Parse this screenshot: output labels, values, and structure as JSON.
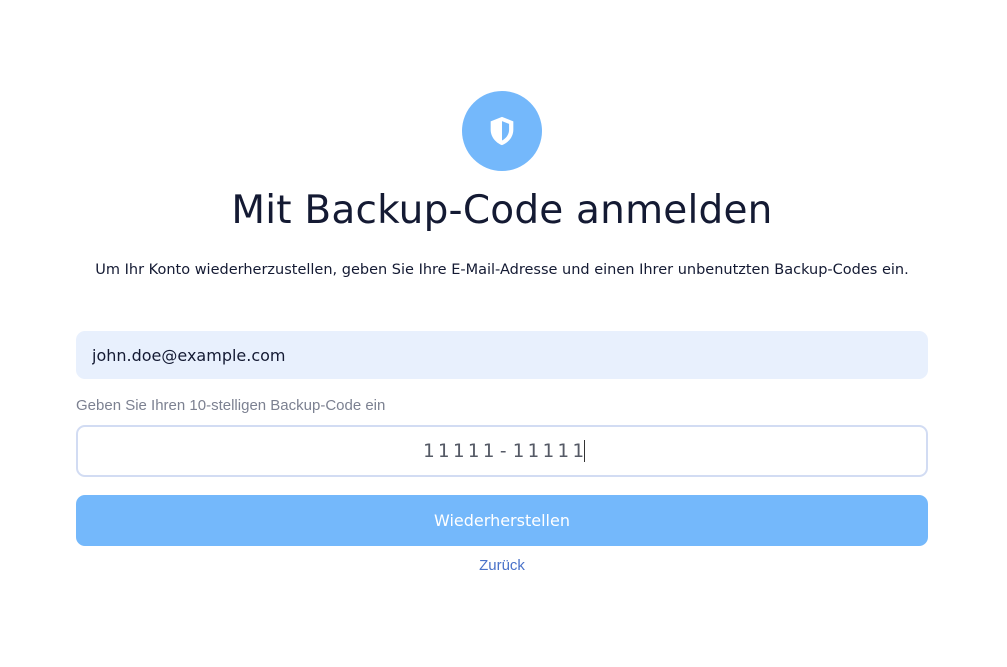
{
  "header": {
    "icon": "shield-icon",
    "icon_color": "#74b8fb",
    "title": "Mit Backup-Code anmelden",
    "description": "Um Ihr Konto wiederherzustellen, geben Sie Ihre E-Mail-Adresse und einen Ihrer unbenutzten Backup-Codes ein."
  },
  "form": {
    "email_value": "john.doe@example.com",
    "code_label": "Geben Sie Ihren 10-stelligen Backup-Code ein",
    "code_value": "11111-11111",
    "submit_label": "Wiederherstellen",
    "back_label": "Zurück"
  },
  "colors": {
    "accent": "#74b8fb",
    "link": "#4a72c9",
    "input_bg": "#e8f0fd",
    "text": "#141a33"
  }
}
